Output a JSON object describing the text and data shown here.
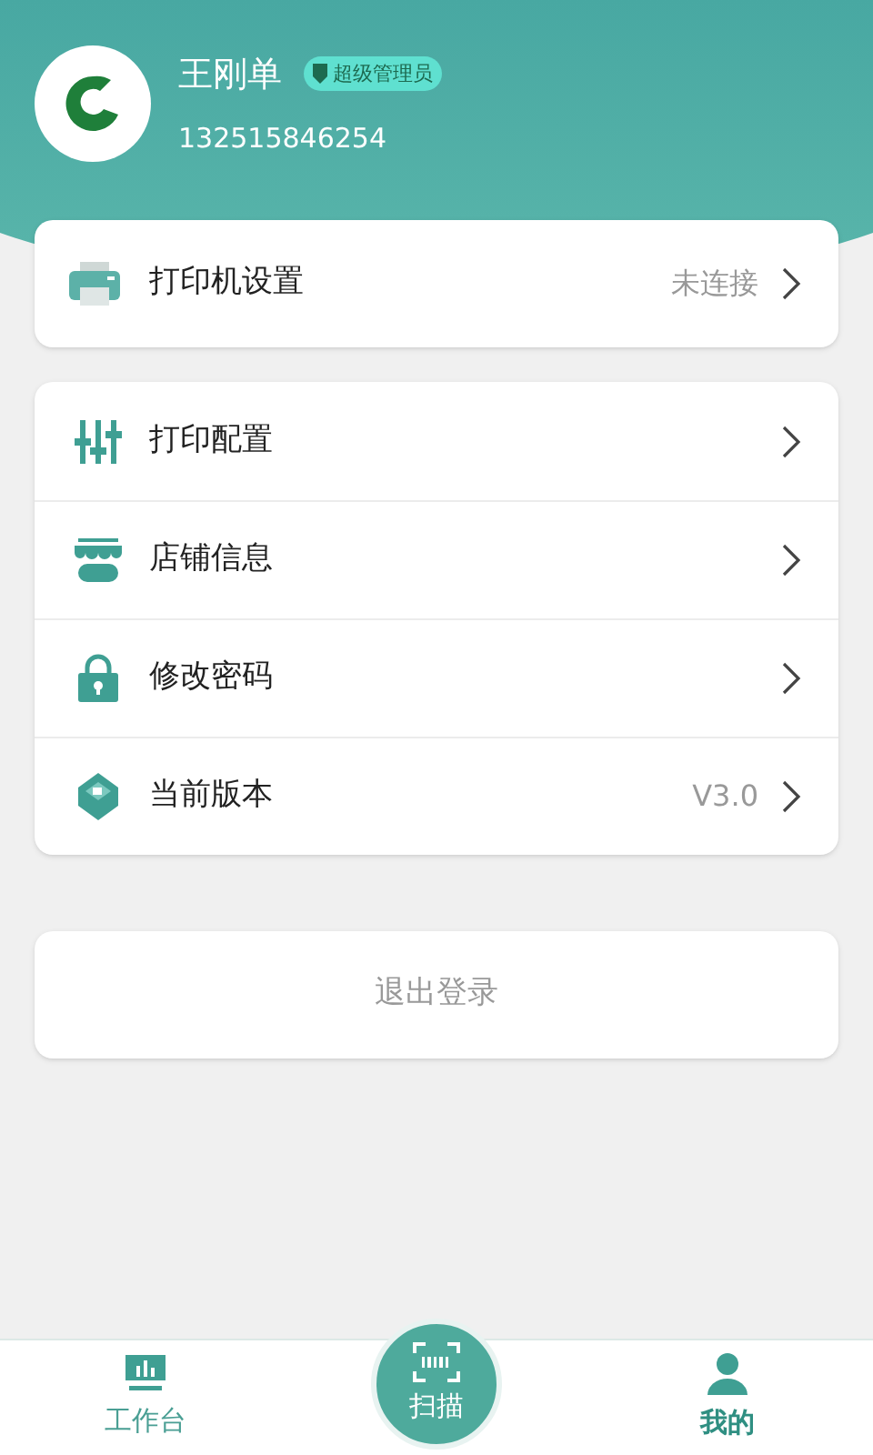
{
  "profile": {
    "name": "王刚单",
    "badge": "超级管理员",
    "phone": "132515846254"
  },
  "printer": {
    "label": "打印机设置",
    "value": "未连接"
  },
  "menu": [
    {
      "kind": "sliders",
      "label": "打印配置"
    },
    {
      "kind": "store",
      "label": "店铺信息"
    },
    {
      "kind": "lock",
      "label": "修改密码"
    },
    {
      "kind": "version",
      "label": "当前版本",
      "value": "V3.0"
    }
  ],
  "logout": "退出登录",
  "nav": [
    {
      "kind": "workbench",
      "label": "工作台",
      "selected": false
    },
    {
      "kind": "scan",
      "label": "扫描",
      "selected": false
    },
    {
      "kind": "profile",
      "label": "我的",
      "selected": true
    }
  ]
}
